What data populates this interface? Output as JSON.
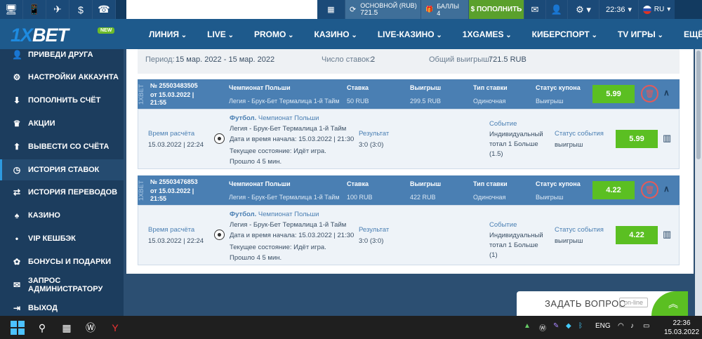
{
  "topbar": {
    "account_label": "ОСНОВНОЙ (RUB)",
    "account_value": "721.5",
    "bonus_label": "БАЛЛЫ",
    "bonus_value": "4",
    "deposit_label": "ПОПОЛНИТЬ",
    "time": "22:36",
    "lang": "RU"
  },
  "logo": {
    "text_a": "1X",
    "text_b": "BET",
    "badge": "NEW"
  },
  "nav": [
    "ЛИНИЯ",
    "LIVE",
    "PROMO",
    "КАЗИНО",
    "LIVE-КАЗИНО",
    "1XGAMES",
    "КИБЕРСПОРТ",
    "TV ИГРЫ",
    "ЕЩЁ"
  ],
  "sidebar": [
    {
      "icon": "user-plus-icon",
      "glyph": "👤",
      "label": "ПРИВЕДИ ДРУГА"
    },
    {
      "icon": "gears-icon",
      "glyph": "⚙",
      "label": "НАСТРОЙКИ АККАУНТА"
    },
    {
      "icon": "download-icon",
      "glyph": "⬇",
      "label": "ПОПОЛНИТЬ СЧЁТ"
    },
    {
      "icon": "trophy-icon",
      "glyph": "🏆",
      "label": "АКЦИИ"
    },
    {
      "icon": "upload-icon",
      "glyph": "⬆",
      "label": "ВЫВЕСТИ СО СЧЁТА"
    },
    {
      "icon": "history-icon",
      "glyph": "◷",
      "label": "ИСТОРИЯ СТАВОК"
    },
    {
      "icon": "transfer-icon",
      "glyph": "⇄",
      "label": "ИСТОРИЯ ПЕРЕВОДОВ"
    },
    {
      "icon": "cards-icon",
      "glyph": "🂡",
      "label": "КАЗИНО"
    },
    {
      "icon": "dot-icon",
      "glyph": "•",
      "label": "VIP КЕШБЭК"
    },
    {
      "icon": "gift-icon",
      "glyph": "🎁",
      "label": "БОНУСЫ И ПОДАРКИ"
    },
    {
      "icon": "envelope-icon",
      "glyph": "✉",
      "label": "ЗАПРОС АДМИНИСТРАТОРУ"
    },
    {
      "icon": "exit-icon",
      "glyph": "⇥",
      "label": "ВЫХОД"
    }
  ],
  "summary": {
    "period_label": "Период:",
    "period_value": "15 мар. 2022 - 15 мар. 2022",
    "count_label": "Число ставок:",
    "count_value": "2",
    "win_label": "Общий выигрыш:",
    "win_value": "721.5 RUB"
  },
  "bets": [
    {
      "number": "№ 25503483505",
      "date": "от 15.03.2022 | 21:55",
      "championship_h": "Чемпионат Польши",
      "championship_v": "Легия - Брук-Бет Термалица 1-й Тайм",
      "stake_h": "Ставка",
      "stake_v": "50 RUB",
      "win_h": "Выигрыш",
      "win_v": "299.5 RUB",
      "type_h": "Тип ставки",
      "type_v": "Одиночная",
      "status_h": "Статус купона",
      "status_v": "Выигрыш",
      "coef": "5.99",
      "calc_h": "Время расчёта",
      "calc_v": "15.03.2022 | 22:24",
      "sport": "Футбол.",
      "league": "Чемпионат Польши",
      "match": "Легия - Брук-Бет Термалица 1-й Тайм",
      "start": "Дата и время начала: 15.03.2022 | 21:30",
      "state": "Текущее состояние: Идёт игра. Прошло 4 5 мин.",
      "result_h": "Результат",
      "result_v": "3:0 (3:0)",
      "event_h": "Событие",
      "event_v": "Индивидуальный тотал 1 Больше (1.5)",
      "evstatus_h": "Статус события",
      "evstatus_v": "выигрыш",
      "ev_coef": "5.99"
    },
    {
      "number": "№ 25503476853",
      "date": "от 15.03.2022 | 21:55",
      "championship_h": "Чемпионат Польши",
      "championship_v": "Легия - Брук-Бет Термалица 1-й Тайм",
      "stake_h": "Ставка",
      "stake_v": "100 RUB",
      "win_h": "Выигрыш",
      "win_v": "422 RUB",
      "type_h": "Тип ставки",
      "type_v": "Одиночная",
      "status_h": "Статус купона",
      "status_v": "Выигрыш",
      "coef": "4.22",
      "calc_h": "Время расчёта",
      "calc_v": "15.03.2022 | 22:24",
      "sport": "Футбол.",
      "league": "Чемпионат Польши",
      "match": "Легия - Брук-Бет Термалица 1-й Тайм",
      "start": "Дата и время начала: 15.03.2022 | 21:30",
      "state": "Текущее состояние: Идёт игра. Прошло 4 5 мин.",
      "result_h": "Результат",
      "result_v": "3:0 (3:0)",
      "event_h": "Событие",
      "event_v": "Индивидуальный тотал 1 Больше (1)",
      "evstatus_h": "Статус события",
      "evstatus_v": "выигрыш",
      "ev_coef": "4.22"
    }
  ],
  "ask": {
    "label": "ЗАДАТЬ ВОПРОС",
    "status": "on-line"
  },
  "taskbar": {
    "lang": "ENG",
    "time": "22:36",
    "date": "15.03.2022"
  },
  "colors": {
    "accent": "#4a7fb3",
    "green": "#5bbf22",
    "sidebar": "#1c3d5e"
  }
}
